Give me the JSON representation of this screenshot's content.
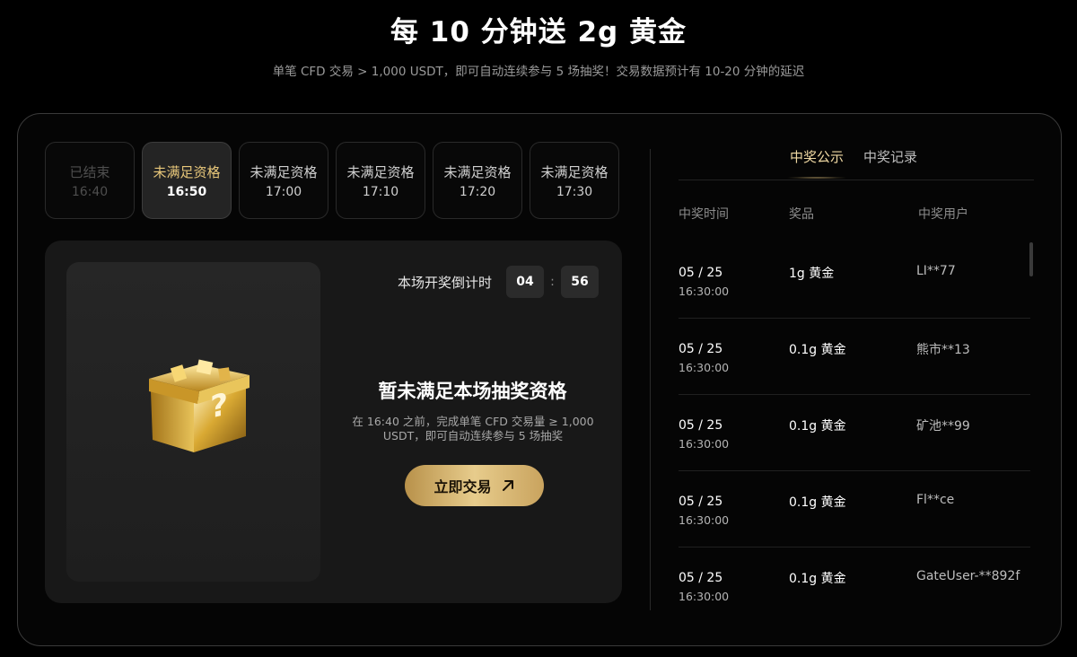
{
  "header": {
    "title": "每 10 分钟送 2g 黄金",
    "subtitle": "单笔 CFD 交易 > 1,000 USDT，即可自动连续参与 5 场抽奖！交易数据预计有 10-20 分钟的延迟"
  },
  "sessions": [
    {
      "label": "已结束",
      "time": "16:40",
      "state": "ended"
    },
    {
      "label": "未满足资格",
      "time": "16:50",
      "state": "active"
    },
    {
      "label": "未满足资格",
      "time": "17:00",
      "state": "upcoming"
    },
    {
      "label": "未满足资格",
      "time": "17:10",
      "state": "upcoming"
    },
    {
      "label": "未满足资格",
      "time": "17:20",
      "state": "upcoming"
    },
    {
      "label": "未满足资格",
      "time": "17:30",
      "state": "upcoming"
    }
  ],
  "countdown": {
    "label": "本场开奖倒计时",
    "minutes": "04",
    "separator": ":",
    "seconds": "56"
  },
  "status": {
    "title": "暂未满足本场抽奖资格",
    "description": "在 16:40 之前，完成单笔 CFD 交易量 ≥ 1,000 USDT，即可自动连续参与 5 场抽奖",
    "button_label": "立即交易",
    "button_icon": "arrow-up-right-icon",
    "image_icon": "gold-mystery-box-icon"
  },
  "winners": {
    "tabs": [
      "中奖公示",
      "中奖记录"
    ],
    "active_tab": 0,
    "columns": [
      "中奖时间",
      "奖品",
      "中奖用户"
    ],
    "rows": [
      {
        "date": "05 / 25",
        "time": "16:30:00",
        "prize": "1g 黄金",
        "user": "LI**77"
      },
      {
        "date": "05 / 25",
        "time": "16:30:00",
        "prize": "0.1g 黄金",
        "user": "熊市**13"
      },
      {
        "date": "05 / 25",
        "time": "16:30:00",
        "prize": "0.1g 黄金",
        "user": "矿池**99"
      },
      {
        "date": "05 / 25",
        "time": "16:30:00",
        "prize": "0.1g 黄金",
        "user": "Fl**ce"
      },
      {
        "date": "05 / 25",
        "time": "16:30:00",
        "prize": "0.1g 黄金",
        "user": "GateUser-**892f"
      }
    ]
  },
  "colors": {
    "background": "#000000",
    "panel": "#181818",
    "accent_gold": "#e8c77a",
    "button_gold": "#d4b06a"
  }
}
